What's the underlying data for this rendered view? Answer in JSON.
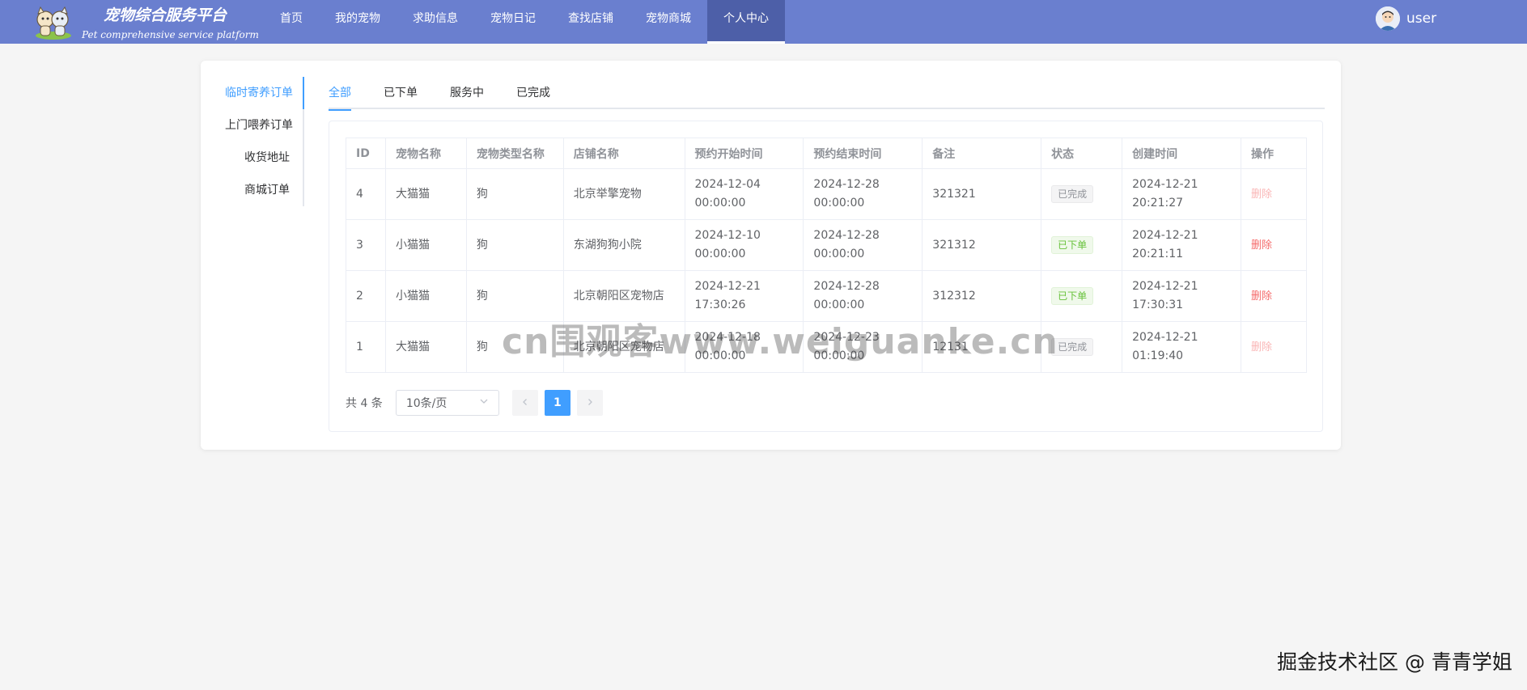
{
  "header": {
    "brand_cn": "宠物综合服务平台",
    "brand_en": "Pet comprehensive service platform",
    "nav": [
      "首页",
      "我的宠物",
      "求助信息",
      "宠物日记",
      "查找店铺",
      "宠物商城",
      "个人中心"
    ],
    "nav_active": 6,
    "username": "user",
    "bg_color": "#6a7fcf",
    "active_bg_color": "#4d5fa8"
  },
  "side_menu": {
    "items": [
      "临时寄养订单",
      "上门喂养订单",
      "收货地址",
      "商城订单"
    ],
    "active": 0
  },
  "tabs": {
    "items": [
      "全部",
      "已下单",
      "服务中",
      "已完成"
    ],
    "active": 0
  },
  "table": {
    "headers": [
      "ID",
      "宠物名称",
      "宠物类型名称",
      "店铺名称",
      "预约开始时间",
      "预约结束时间",
      "备注",
      "状态",
      "创建时间",
      "操作"
    ],
    "rows": [
      {
        "id": "4",
        "pet": "大猫猫",
        "type": "狗",
        "shop": "北京举擎宠物",
        "start_date": "2024-12-04",
        "start_time": "00:00:00",
        "end_date": "2024-12-28",
        "end_time": "00:00:00",
        "note": "321321",
        "status": "已完成",
        "status_kind": "done",
        "created_date": "2024-12-21",
        "created_time": "20:21:27",
        "op": "删除",
        "op_disabled": true
      },
      {
        "id": "3",
        "pet": "小猫猫",
        "type": "狗",
        "shop": "东湖狗狗小院",
        "start_date": "2024-12-10",
        "start_time": "00:00:00",
        "end_date": "2024-12-28",
        "end_time": "00:00:00",
        "note": "321312",
        "status": "已下单",
        "status_kind": "placed",
        "created_date": "2024-12-21",
        "created_time": "20:21:11",
        "op": "删除",
        "op_disabled": false
      },
      {
        "id": "2",
        "pet": "小猫猫",
        "type": "狗",
        "shop": "北京朝阳区宠物店",
        "start_date": "2024-12-21",
        "start_time": "17:30:26",
        "end_date": "2024-12-28",
        "end_time": "00:00:00",
        "note": "312312",
        "status": "已下单",
        "status_kind": "placed",
        "created_date": "2024-12-21",
        "created_time": "17:30:31",
        "op": "删除",
        "op_disabled": false
      },
      {
        "id": "1",
        "pet": "大猫猫",
        "type": "狗",
        "shop": "北京朝阳区宠物店",
        "start_date": "2024-12-18",
        "start_time": "00:00:00",
        "end_date": "2024-12-23",
        "end_time": "00:00:00",
        "note": "12131",
        "status": "已完成",
        "status_kind": "done",
        "created_date": "2024-12-21",
        "created_time": "01:19:40",
        "op": "删除",
        "op_disabled": true
      }
    ]
  },
  "pagination": {
    "total_text": "共 4 条",
    "page_size": "10条/页",
    "current_page": "1",
    "prev_icon": "chevron-left-icon",
    "next_icon": "chevron-right-icon"
  },
  "watermark": "cn围观客www.weiguanke.cn",
  "credit": "掘金技术社区 @ 青青学姐",
  "colors": {
    "primary": "#409eff",
    "danger": "#f56c6c",
    "success": "#67c23a"
  }
}
